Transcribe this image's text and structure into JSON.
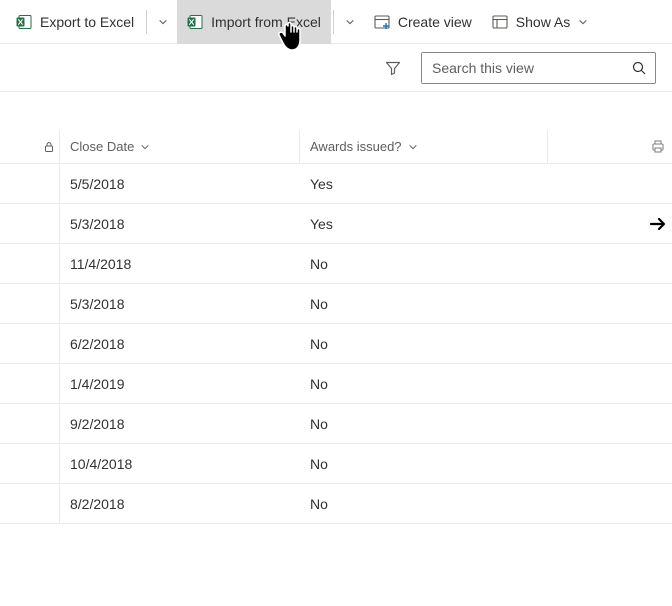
{
  "toolbar": {
    "export_label": "Export to Excel",
    "import_label": "Import from Excel",
    "createview_label": "Create view",
    "showas_label": "Show As"
  },
  "search": {
    "placeholder": "Search this view"
  },
  "columns": {
    "close_date": "Close Date",
    "awards_issued": "Awards issued?"
  },
  "rows": [
    {
      "close_date": "5/5/2018",
      "awards": "Yes",
      "arrow": false
    },
    {
      "close_date": "5/3/2018",
      "awards": "Yes",
      "arrow": true
    },
    {
      "close_date": "11/4/2018",
      "awards": "No",
      "arrow": false
    },
    {
      "close_date": "5/3/2018",
      "awards": "No",
      "arrow": false
    },
    {
      "close_date": "6/2/2018",
      "awards": "No",
      "arrow": false
    },
    {
      "close_date": "1/4/2019",
      "awards": "No",
      "arrow": false
    },
    {
      "close_date": "9/2/2018",
      "awards": "No",
      "arrow": false
    },
    {
      "close_date": "10/4/2018",
      "awards": "No",
      "arrow": false
    },
    {
      "close_date": "8/2/2018",
      "awards": "No",
      "arrow": false
    }
  ]
}
